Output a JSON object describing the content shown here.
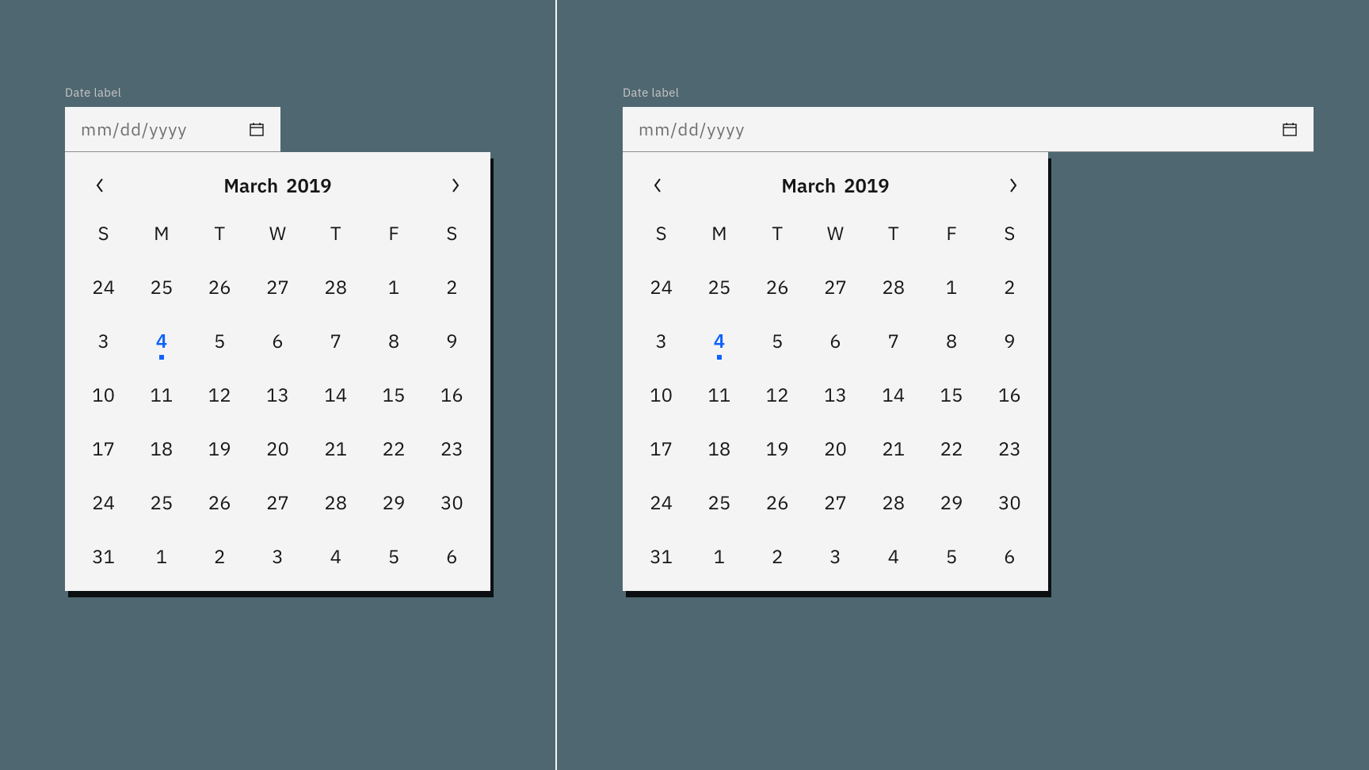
{
  "label": "Date label",
  "placeholder": "mm/dd/yyyy",
  "calendar": {
    "month": "March",
    "year": "2019",
    "weekdays": [
      "S",
      "M",
      "T",
      "W",
      "T",
      "F",
      "S"
    ],
    "days": [
      {
        "n": 24
      },
      {
        "n": 25
      },
      {
        "n": 26
      },
      {
        "n": 27
      },
      {
        "n": 28
      },
      {
        "n": 1
      },
      {
        "n": 2
      },
      {
        "n": 3
      },
      {
        "n": 4,
        "today": true
      },
      {
        "n": 5
      },
      {
        "n": 6
      },
      {
        "n": 7
      },
      {
        "n": 8
      },
      {
        "n": 9
      },
      {
        "n": 10
      },
      {
        "n": 11
      },
      {
        "n": 12
      },
      {
        "n": 13
      },
      {
        "n": 14
      },
      {
        "n": 15
      },
      {
        "n": 16
      },
      {
        "n": 17
      },
      {
        "n": 18
      },
      {
        "n": 19
      },
      {
        "n": 20
      },
      {
        "n": 21
      },
      {
        "n": 22
      },
      {
        "n": 23
      },
      {
        "n": 24
      },
      {
        "n": 25
      },
      {
        "n": 26
      },
      {
        "n": 27
      },
      {
        "n": 28
      },
      {
        "n": 29
      },
      {
        "n": 30
      },
      {
        "n": 31
      },
      {
        "n": 1
      },
      {
        "n": 2
      },
      {
        "n": 3
      },
      {
        "n": 4
      },
      {
        "n": 5
      },
      {
        "n": 6
      }
    ]
  },
  "colors": {
    "accent": "#0f62fe",
    "background": "#4f6770",
    "surface": "#f4f4f4"
  }
}
